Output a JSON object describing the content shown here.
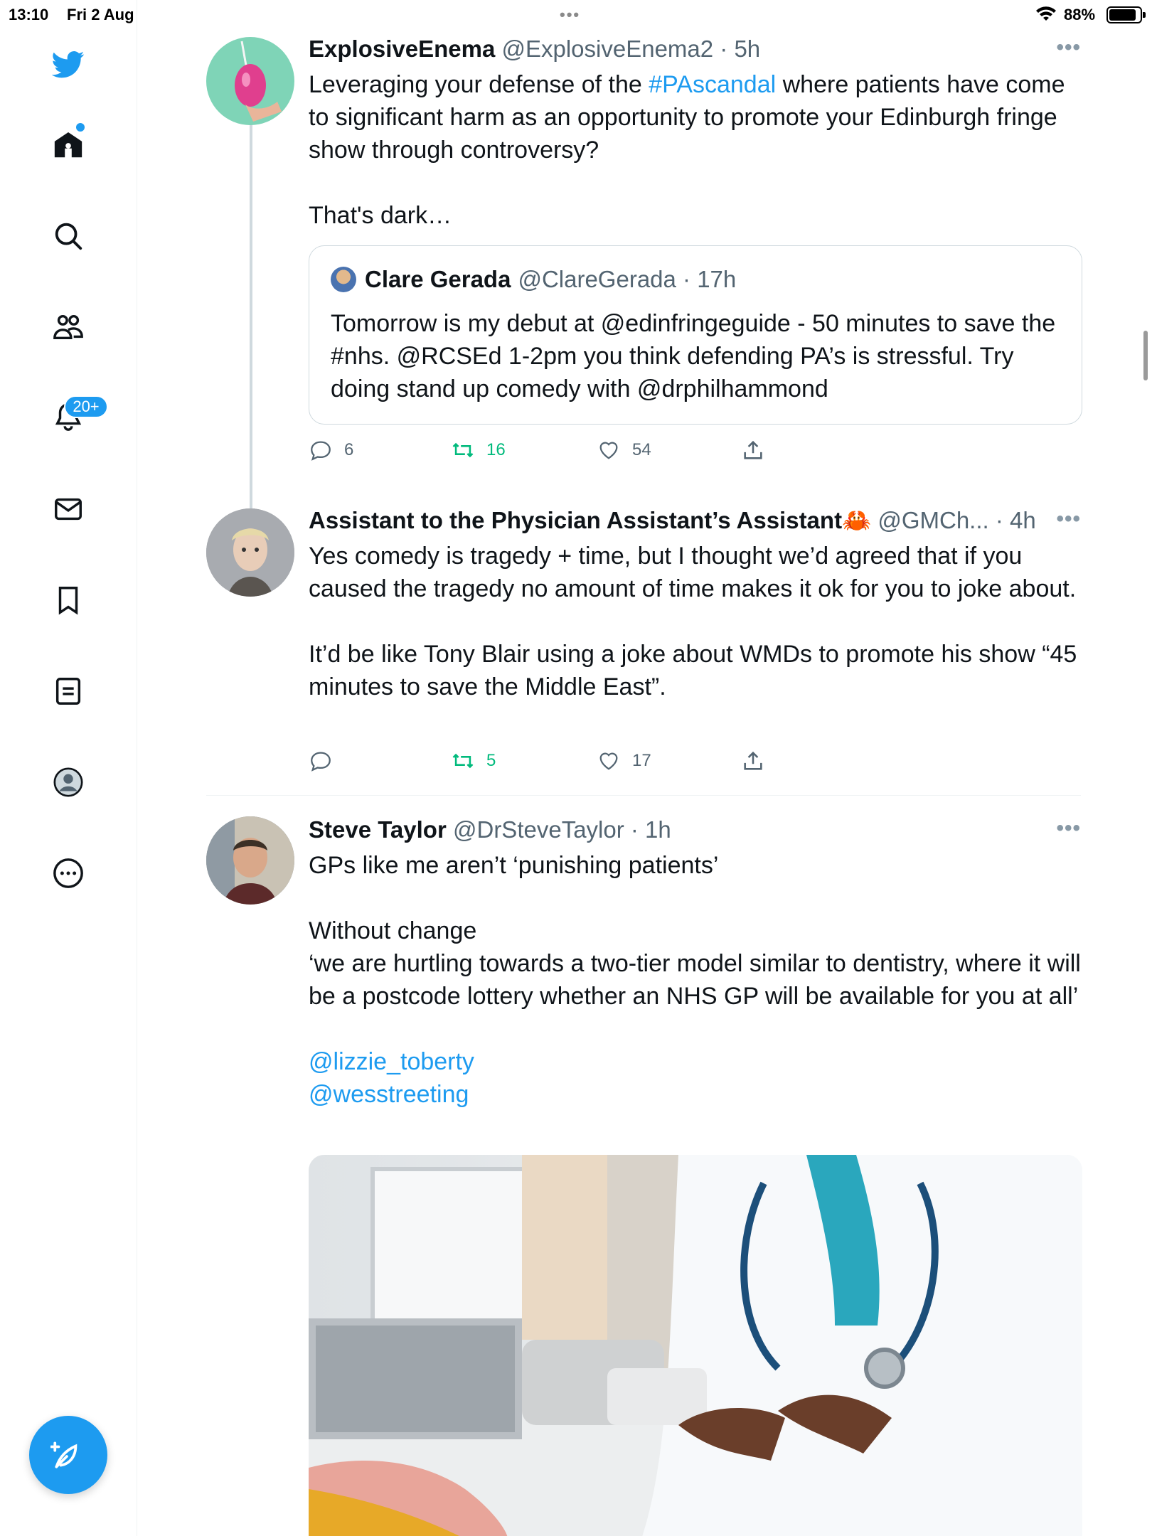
{
  "status_bar": {
    "time": "13:10",
    "date": "Fri 2 Aug",
    "battery": "88%",
    "battery_level": 0.88
  },
  "sidebar": {
    "nav": [
      {
        "name": "twitter-logo-icon"
      },
      {
        "name": "home-icon"
      },
      {
        "name": "search-icon"
      },
      {
        "name": "communities-icon"
      },
      {
        "name": "notifications-icon"
      },
      {
        "name": "messages-icon"
      },
      {
        "name": "bookmarks-icon"
      },
      {
        "name": "lists-icon"
      },
      {
        "name": "profile-icon"
      },
      {
        "name": "more-icon"
      }
    ],
    "notifications_badge": "20+",
    "compose_icon": "compose-icon"
  },
  "tweets": [
    {
      "name": "ExplosiveEnema",
      "handle": "@ExplosiveEnema2 · 5h",
      "body_pre": "Leveraging your defense of the ",
      "hashtag": "#PAscandal",
      "body_post": " where patients have come to significant harm as an opportunity to promote your Edinburgh fringe show through controversy?",
      "body_line2": "That's dark…",
      "quote": {
        "name": "Clare Gerada",
        "handle": "@ClareGerada · 17h",
        "text": "Tomorrow is my debut at @edinfringeguide - 50 minutes to save the #nhs. @RCSEd 1-2pm you think defending PA’s is stressful. Try doing stand up comedy with @drphilhammond"
      },
      "replies": "6",
      "retweets": "16",
      "likes": "54"
    },
    {
      "name": "Assistant to the Physician Assistant’s Assistant🦀",
      "handle": "@GMCh... · 4h",
      "body_para1": "Yes comedy is tragedy + time, but I thought we’d agreed that if you caused the tragedy no amount of time makes it ok for you to joke about.",
      "body_para2": "It’d be like Tony Blair using a joke about WMDs to promote his show “45 minutes to save the Middle East”.",
      "replies": "",
      "retweets": "5",
      "likes": "17"
    },
    {
      "name": "Steve Taylor",
      "handle": "@DrSteveTaylor · 1h",
      "body_line1": "GPs like me aren’t ‘punishing patients’",
      "body_line2": "Without change",
      "body_line3": "‘we are hurtling towards a two-tier model similar to dentistry, where it will be a postcode lottery whether an NHS GP will be available for you at all’",
      "mention1": "@lizzie_toberty",
      "mention2": "@wesstreeting"
    }
  ],
  "colors": {
    "accent": "#1d9bf0",
    "retweet": "#00ba7c",
    "muted": "#536471",
    "border": "#cfd9de"
  }
}
